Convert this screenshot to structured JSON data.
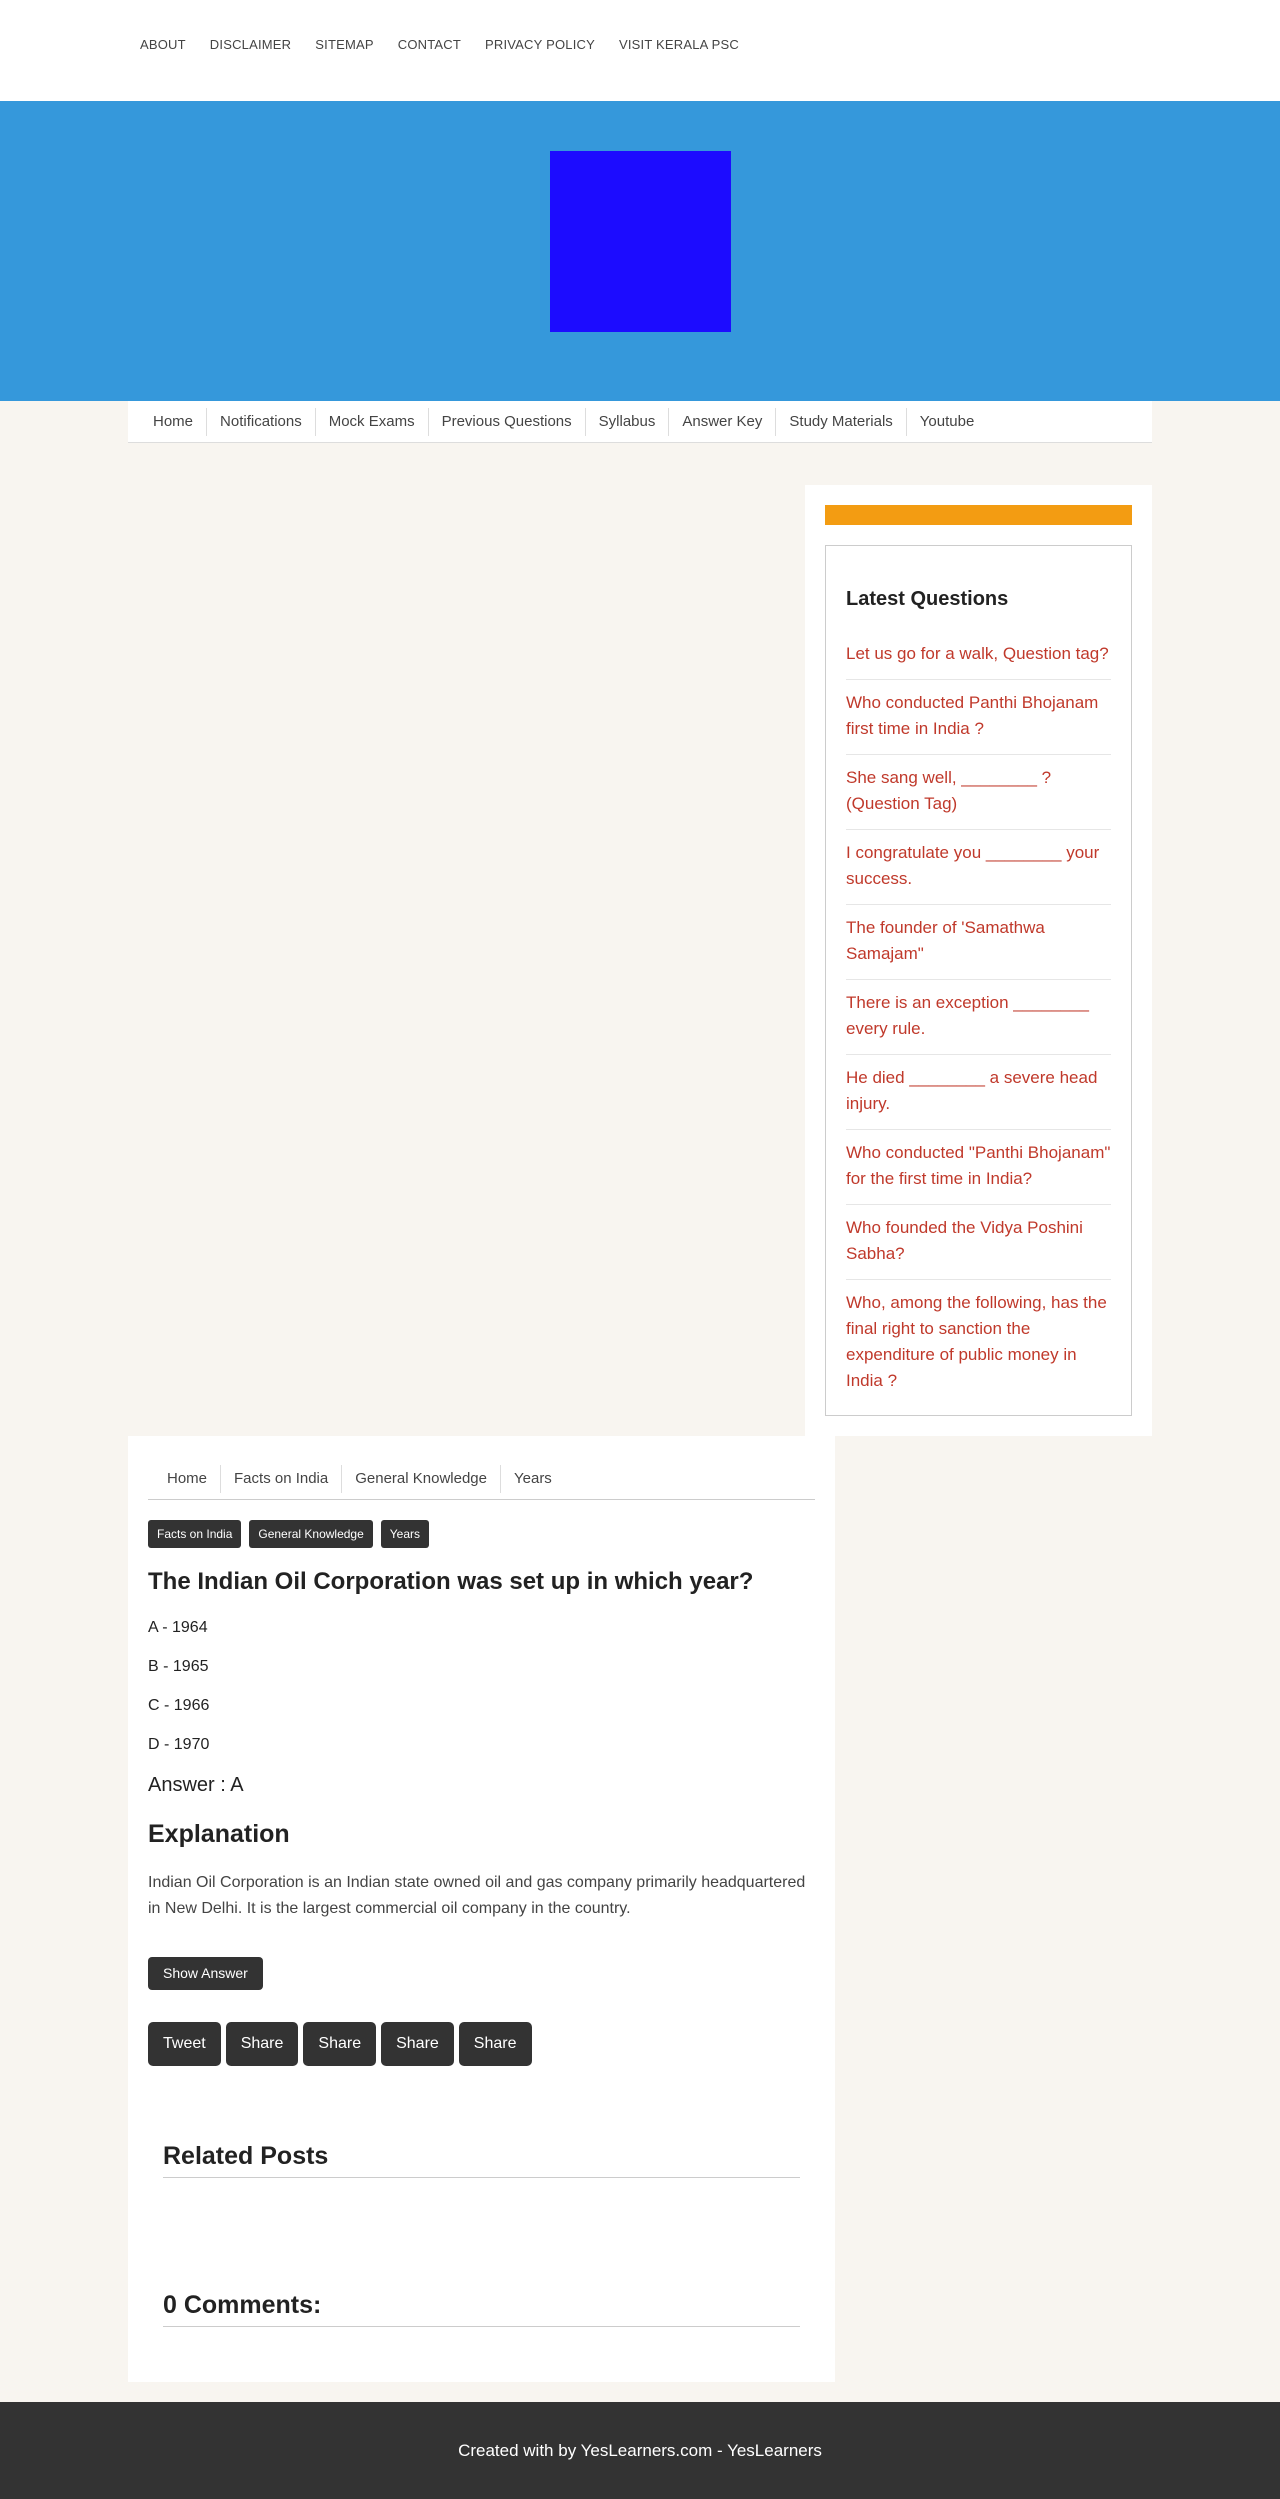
{
  "top_nav": [
    "ABOUT",
    "DISCLAIMER",
    "SITEMAP",
    "CONTACT",
    "PRIVACY POLICY",
    "VISIT KERALA PSC"
  ],
  "main_nav": [
    "Home",
    "Notifications",
    "Mock Exams",
    "Previous Questions",
    "Syllabus",
    "Answer Key",
    "Study Materials",
    "Youtube"
  ],
  "colors": {
    "banner": "#3598db",
    "logo": "#1c0cff",
    "accent_bar": "#f39c12",
    "link": "#c0392b",
    "dark": "#333333"
  },
  "sidebar": {
    "title": "Latest Questions",
    "questions": [
      "Let us go for a walk, Question tag?",
      "Who conducted Panthi Bhojanam first time in India ?",
      "She sang well, ________ ? (Question Tag)",
      "I congratulate you ________ your success.",
      "The founder of 'Samathwa Samajam\"",
      "There is an exception ________ every rule.",
      "He died ________ a severe head injury.",
      "Who conducted \"Panthi Bhojanam\" for the first time in India?",
      "Who founded the Vidya Poshini Sabha?",
      "Who, among the following, has the final right to sanction the expenditure of public money in India ?"
    ]
  },
  "breadcrumb": [
    "Home",
    "Facts on India",
    "General Knowledge",
    "Years"
  ],
  "tags": [
    "Facts on India",
    "General Knowledge",
    "Years"
  ],
  "question": {
    "title": "The Indian Oil Corporation was set up in which year?",
    "options": [
      "A - 1964",
      "B - 1965",
      "C - 1966",
      "D - 1970"
    ],
    "answer": "Answer : A",
    "explanation_title": "Explanation",
    "explanation": "Indian Oil Corporation is an Indian state owned oil and gas company primarily headquartered in New Delhi. It is the largest commercial oil company in the country.",
    "show_answer_label": "Show Answer"
  },
  "share_buttons": [
    "Tweet",
    "Share",
    "Share",
    "Share",
    "Share"
  ],
  "related_posts_title": "Related Posts",
  "comments_title": "0 Comments:",
  "footer": "Created with by YesLearners.com - YesLearners"
}
